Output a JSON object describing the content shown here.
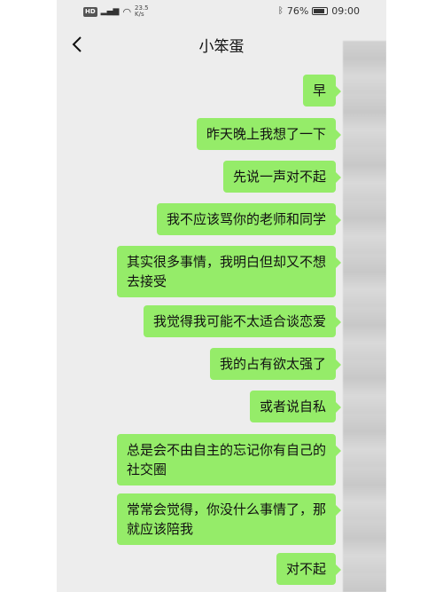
{
  "status": {
    "hd": "HD",
    "signal": "⁴⁶",
    "speed_value": "23.5",
    "speed_unit": "K/s",
    "battery": "76%",
    "time": "09:00"
  },
  "header": {
    "title": "小笨蛋"
  },
  "messages": [
    "早",
    "昨天晚上我想了一下",
    "先说一声对不起",
    "我不应该骂你的老师和同学",
    "其实很多事情，我明白但却又不想\n去接受",
    "我觉得我可能不太适合谈恋爱",
    "我的占有欲太强了",
    "或者说自私",
    "总是会不由自主的忘记你有自己的\n社交圈",
    "常常会觉得，你没什么事情了，那\n就应该陪我",
    "对不起"
  ],
  "colors": {
    "bubble": "#95ec69",
    "background": "#ededed"
  }
}
